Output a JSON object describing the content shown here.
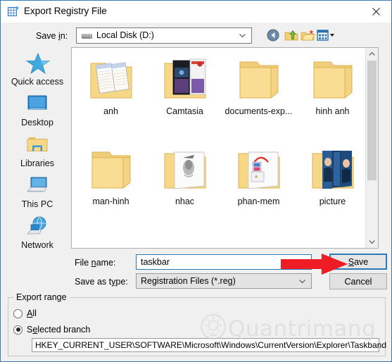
{
  "window": {
    "title": "Export Registry File",
    "icon": "registry-editor-icon",
    "close_label": "✕"
  },
  "toolbar": {
    "savein_label_pre": "Save ",
    "savein_label_accel": "i",
    "savein_label_post": "n:",
    "savein_value": "Local Disk (D:)",
    "buttons": [
      {
        "name": "back-button",
        "title": "Back"
      },
      {
        "name": "up-one-level-button",
        "title": "Up One Level"
      },
      {
        "name": "create-new-folder-button",
        "title": "Create New Folder"
      },
      {
        "name": "views-button",
        "title": "Views"
      }
    ]
  },
  "places": [
    {
      "label": "Quick access",
      "icon": "quick-access-star-icon"
    },
    {
      "label": "Desktop",
      "icon": "desktop-monitor-icon"
    },
    {
      "label": "Libraries",
      "icon": "libraries-folder-icon"
    },
    {
      "label": "This PC",
      "icon": "this-pc-computer-icon"
    },
    {
      "label": "Network",
      "icon": "network-globe-icon"
    }
  ],
  "files": [
    {
      "label": "anh",
      "icon": "folder-with-documents-icon"
    },
    {
      "label": "Camtasia",
      "icon": "folder-with-media-icon"
    },
    {
      "label": "documents-exp...",
      "icon": "folder-empty-icon"
    },
    {
      "label": "hinh anh",
      "icon": "folder-empty-icon"
    },
    {
      "label": "man-hinh",
      "icon": "folder-empty-icon"
    },
    {
      "label": "nhac",
      "icon": "folder-with-photo-icon"
    },
    {
      "label": "phan-mem",
      "icon": "folder-with-app-icon"
    },
    {
      "label": "picture",
      "icon": "folder-with-picture-icon"
    }
  ],
  "scrollbar": {
    "up_glyph": "▲",
    "down_glyph": "▼"
  },
  "form": {
    "filename_label_pre": "File ",
    "filename_label_accel": "n",
    "filename_label_post": "ame:",
    "filename_value": "taskbar",
    "savetype_label_pre": "Save as t",
    "savetype_label_accel": "y",
    "savetype_label_post": "pe:",
    "savetype_value": "Registration Files (*.reg)",
    "save_button_accel": "S",
    "save_button_rest": "ave",
    "cancel_button": "Cancel"
  },
  "export_range": {
    "group_title": "Export range",
    "option_all_accel": "A",
    "option_all_rest": "ll",
    "option_all_selected": false,
    "option_branch_pre": "S",
    "option_branch_accel": "e",
    "option_branch_post": "lected branch",
    "option_branch_selected": true,
    "branch_path": "HKEY_CURRENT_USER\\SOFTWARE\\Microsoft\\Windows\\CurrentVersion\\Explorer\\Taskband"
  },
  "annotation": {
    "arrow_color": "#ee1c24",
    "arrow_target": "save-button"
  },
  "watermark": {
    "text": "Quantrimang",
    "color": "#d2d2d2"
  },
  "colors": {
    "accent": "#2a7ab8",
    "dialog_bg": "#f0f0f0",
    "folder": "#f6d888"
  }
}
